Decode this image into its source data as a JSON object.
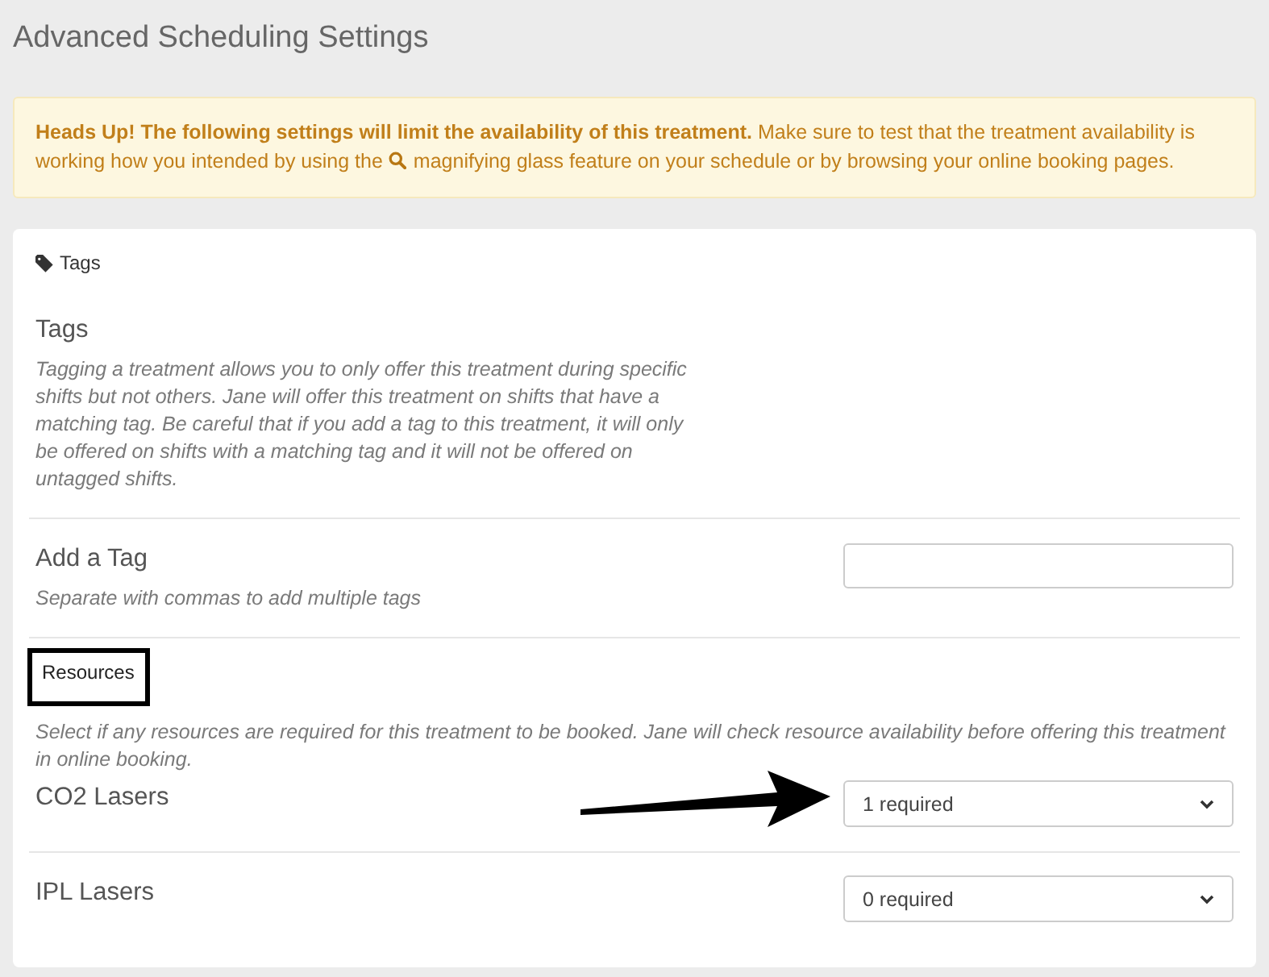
{
  "page": {
    "title": "Advanced Scheduling Settings"
  },
  "alert": {
    "text_before": "**Heads Up! The following settings will limit the availability of this treatment.** Make sure to test that the treatment availability is working how you intended by using the",
    "text_after": "magnifying glass feature on your schedule or by browsing your online booking pages."
  },
  "card": {
    "header": "Tags",
    "tags": {
      "title": "Tags",
      "description": "Tagging a treatment allows you to only offer this treatment during specific shifts but not others. Jane will offer this treatment on shifts that have a matching tag. Be careful that if you add a tag to this treatment, it will only be offered on shifts with a matching tag and it will not be offered on untagged shifts."
    },
    "add_tag": {
      "label": "Add a Tag",
      "hint": "Separate with commas to add multiple tags"
    },
    "resources": {
      "title": "Resources",
      "highlighted": true,
      "description": "Select if any resources are required for this treatment to be booked. Jane will check resource availability before offering this treatment in online booking.",
      "items": [
        {
          "name": "CO2 Lasers",
          "value": "1 required",
          "annotated": true
        },
        {
          "name": "IPL Lasers",
          "value": "0 required",
          "annotated": false
        }
      ]
    }
  }
}
